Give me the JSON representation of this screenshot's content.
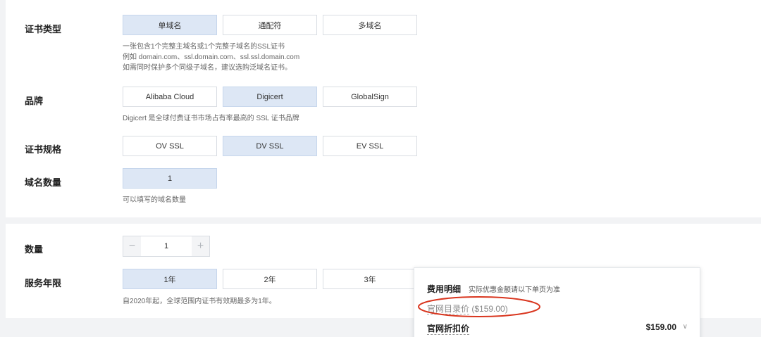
{
  "cert_type": {
    "label": "证书类型",
    "options": [
      "单域名",
      "通配符",
      "多域名"
    ],
    "selected": "单域名",
    "hint_lines": [
      "一张包含1个完整主域名或1个完整子域名的SSL证书",
      "例如 domain.com、ssl.domain.com、ssl.ssl.domain.com",
      "如需同时保护多个同级子域名，建议选购泛域名证书。"
    ]
  },
  "brand": {
    "label": "品牌",
    "options": [
      "Alibaba Cloud",
      "Digicert",
      "GlobalSign"
    ],
    "selected": "Digicert",
    "hint": "Digicert 是全球付费证书市场占有率最高的 SSL 证书品牌"
  },
  "spec": {
    "label": "证书规格",
    "options": [
      "OV SSL",
      "DV SSL",
      "EV SSL"
    ],
    "selected": "DV SSL"
  },
  "domain_count": {
    "label": "域名数量",
    "value": "1",
    "hint": "可以填写的域名数量"
  },
  "quantity": {
    "label": "数量",
    "minus": "−",
    "value": "1",
    "plus": "+"
  },
  "duration": {
    "label": "服务年限",
    "options": [
      "1年",
      "2年",
      "3年"
    ],
    "selected": "1年",
    "hint": "自2020年起，全球范围内证书有效期最多为1年。"
  },
  "fee": {
    "title": "费用明细",
    "note": "实际优惠金额请以下单页为准",
    "list_price_label": "官网目录价",
    "list_price_value": "($159.00)",
    "discount_label": "官网折扣价",
    "discount_value": "$159.00",
    "chevron": "∨"
  },
  "colors": {
    "selected_bg": "#dde7f5",
    "annotation_red": "#d9361f"
  }
}
